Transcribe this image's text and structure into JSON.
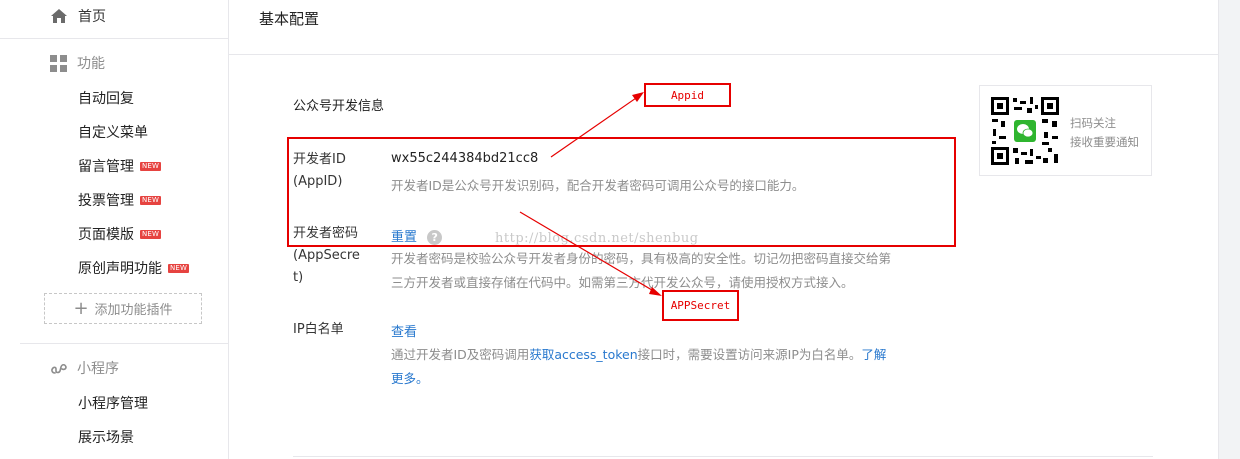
{
  "sidebar": {
    "home": "首页",
    "features_header": "功能",
    "features": [
      {
        "label": "自动回复",
        "new": false
      },
      {
        "label": "自定义菜单",
        "new": false
      },
      {
        "label": "留言管理",
        "new": true
      },
      {
        "label": "投票管理",
        "new": true
      },
      {
        "label": "页面模版",
        "new": true
      },
      {
        "label": "原创声明功能",
        "new": true
      }
    ],
    "new_badge": "NEW",
    "add_plugin": "添加功能插件",
    "miniprogram_header": "小程序",
    "miniprogram_items": [
      "小程序管理",
      "展示场景"
    ]
  },
  "main": {
    "title": "基本配置",
    "section_title": "公众号开发信息",
    "appid": {
      "label_line1": "开发者ID",
      "label_line2": "(AppID)",
      "value": "wx55c244384bd21cc8",
      "desc": "开发者ID是公众号开发识别码，配合开发者密码可调用公众号的接口能力。"
    },
    "secret": {
      "label_line1": "开发者密码",
      "label_line2": "(AppSecre",
      "label_line3": "t)",
      "reset_link": "重置",
      "help": "?",
      "desc_line1": "开发者密码是校验公众号开发者身份的密码，具有极高的安全性。切记勿把密码直接交给第",
      "desc_line2": "三方开发者或直接存储在代码中。如需第三方代开发公众号，请使用授权方式接入。"
    },
    "ip_whitelist": {
      "label": "IP白名单",
      "view_link": "查看",
      "desc_prefix": "通过开发者ID及密码调用",
      "desc_link": "获取access_token",
      "desc_mid": "接口时，需要设置访问来源IP为白名单。",
      "desc_more1": "了解",
      "desc_more2": "更多。"
    },
    "qr": {
      "line1": "扫码关注",
      "line2": "接收重要通知"
    }
  },
  "annotations": {
    "appid_label": "Appid",
    "secret_label": "APPSecret",
    "watermark": "http://blog.csdn.net/shenbug",
    "color": "#e60000"
  }
}
